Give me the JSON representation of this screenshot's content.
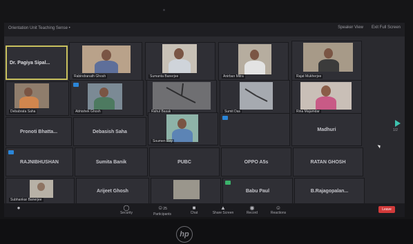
{
  "window": {
    "meeting_title": "Orientation Unit Teaching Sense •",
    "speaker_view_label": "Speaker View",
    "fullscreen_label": "Exit Full Screen"
  },
  "participants": [
    {
      "name": "Dr. Pagiya Sipal..."
    },
    {
      "name": "Rabindranath Ghosh"
    },
    {
      "name": "Sumanta Banerjee"
    },
    {
      "name": "Anirban Mitra"
    },
    {
      "name": "Rajat Mukherjee"
    },
    {
      "name": "Debabrata Saha"
    },
    {
      "name": "Abhishek Ghosh"
    },
    {
      "name": "Rahul Basak"
    },
    {
      "name": "Sumit Das"
    },
    {
      "name": "Rina Majumdar"
    },
    {
      "name": "Pronoti Bhatta..."
    },
    {
      "name": "Debasish Saha"
    },
    {
      "name": "Soumen Roy"
    },
    {
      "name": ""
    },
    {
      "name": "Madhuri"
    },
    {
      "name": "RAJNIBHUSHAN"
    },
    {
      "name": "Sumita Banik"
    },
    {
      "name": "PUBC"
    },
    {
      "name": "OPPO A5s"
    },
    {
      "name": "RATAN GHOSH"
    },
    {
      "name": "Subhankar Banerjee"
    },
    {
      "name": "Arijeet Ghosh"
    },
    {
      "name": ""
    },
    {
      "name": "Babu Paul"
    },
    {
      "name": "B.Rajagopalan..."
    }
  ],
  "controls": {
    "security": "Security",
    "participants": "Participants",
    "participants_count": "25",
    "chat": "Chat",
    "share": "Share Screen",
    "record": "Record",
    "reactions": "Reactions",
    "end": "Leave"
  },
  "pagination": "1/2",
  "brand": "hp"
}
